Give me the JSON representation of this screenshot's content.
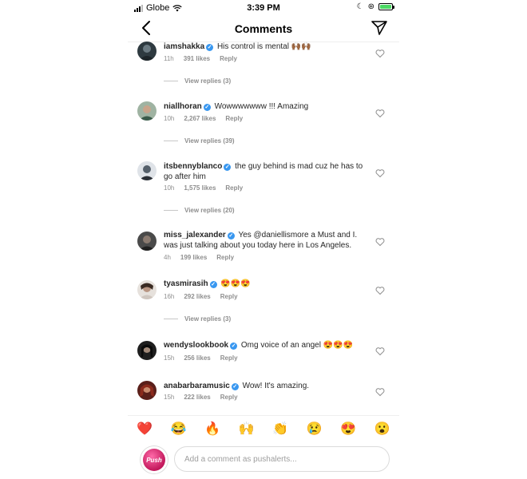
{
  "status_bar": {
    "carrier": "Globe",
    "time": "3:39 PM"
  },
  "header": {
    "title": "Comments"
  },
  "comments": [
    {
      "username": "iamshakka",
      "text": "His control is mental 🙌🏾🙌🏾",
      "time": "11h",
      "likes": "391 likes",
      "reply": "Reply",
      "view_replies": "View replies (3)"
    },
    {
      "username": "niallhoran",
      "text": "Wowwwwwww !!! Amazing",
      "time": "10h",
      "likes": "2,267 likes",
      "reply": "Reply",
      "view_replies": "View replies (39)"
    },
    {
      "username": "itsbennyblanco",
      "text": "the guy behind is mad cuz he has to go after him",
      "time": "10h",
      "likes": "1,575 likes",
      "reply": "Reply",
      "view_replies": "View replies (20)"
    },
    {
      "username": "miss_jalexander",
      "text": "Yes @daniellismore a Must and I. was just talking about you today here in Los Angeles.",
      "time": "4h",
      "likes": "199 likes",
      "reply": "Reply"
    },
    {
      "username": "tyasmirasih",
      "text": "😍😍😍",
      "time": "16h",
      "likes": "292 likes",
      "reply": "Reply",
      "view_replies": "View replies (3)"
    },
    {
      "username": "wendyslookbook",
      "text": "Omg voice of an angel 😍😍😍",
      "time": "15h",
      "likes": "256 likes",
      "reply": "Reply"
    },
    {
      "username": "anabarbaramusic",
      "text": "Wow! It's amazing.",
      "time": "15h",
      "likes": "222 likes",
      "reply": "Reply"
    }
  ],
  "emoji_bar": [
    "❤️",
    "😂",
    "🔥",
    "🙌",
    "👏",
    "😢",
    "😍",
    "😮"
  ],
  "composer": {
    "avatar_label": "Push",
    "placeholder": "Add a comment as pushalerts..."
  }
}
